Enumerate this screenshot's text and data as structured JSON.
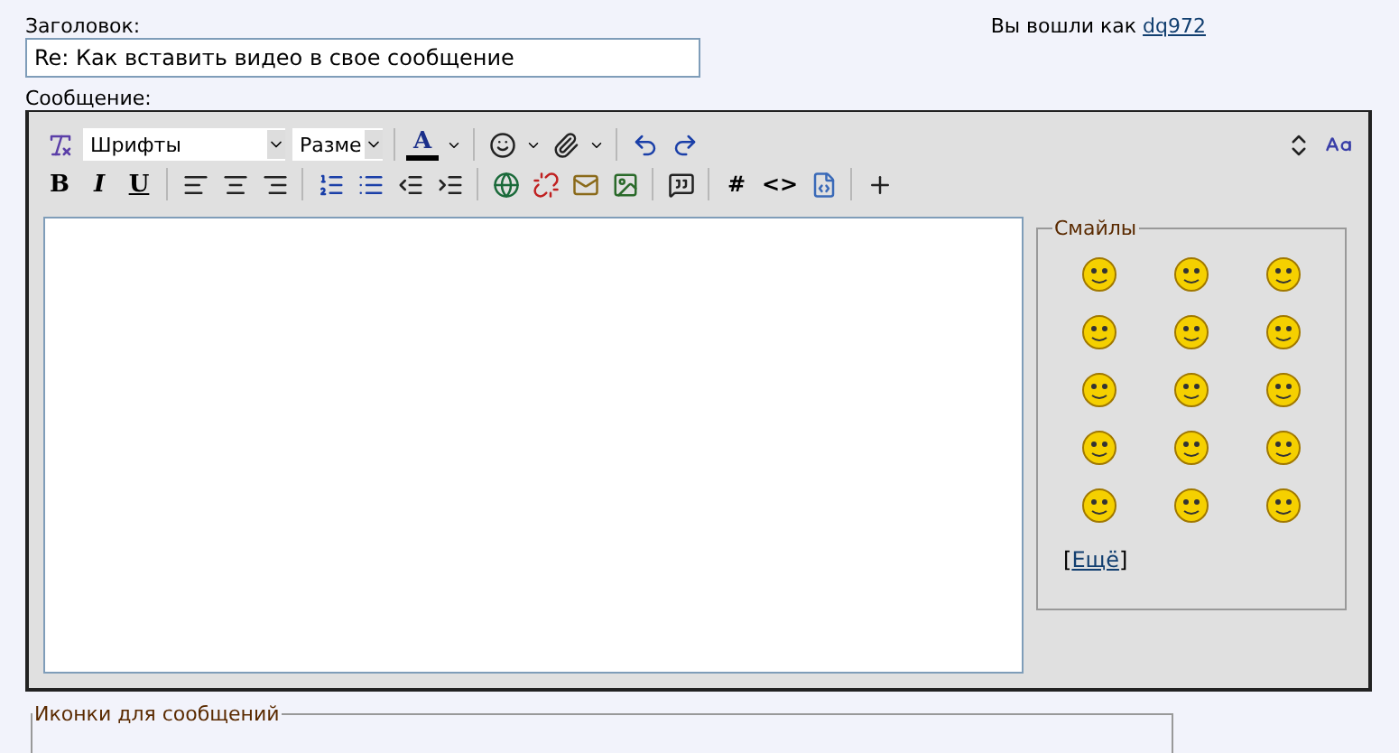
{
  "subject": {
    "label": "Заголовок:",
    "value": "Re: Как вставить видео в свое сообщение"
  },
  "login": {
    "text": "Вы вошли как",
    "user": "dq972"
  },
  "message": {
    "label": "Сообщение:"
  },
  "toolbar": {
    "font_select": "Шрифты",
    "size_select": "Разме",
    "format_buttons": [
      "B",
      "I",
      "U"
    ],
    "code_buttons": [
      "#",
      "<>"
    ],
    "font_color_letter": "A"
  },
  "smilies": {
    "legend": "Смайлы",
    "more_link": "Ещё",
    "bracket_open": "[",
    "bracket_close": "]"
  },
  "post_icons": {
    "legend": "Иконки для сообщений"
  }
}
